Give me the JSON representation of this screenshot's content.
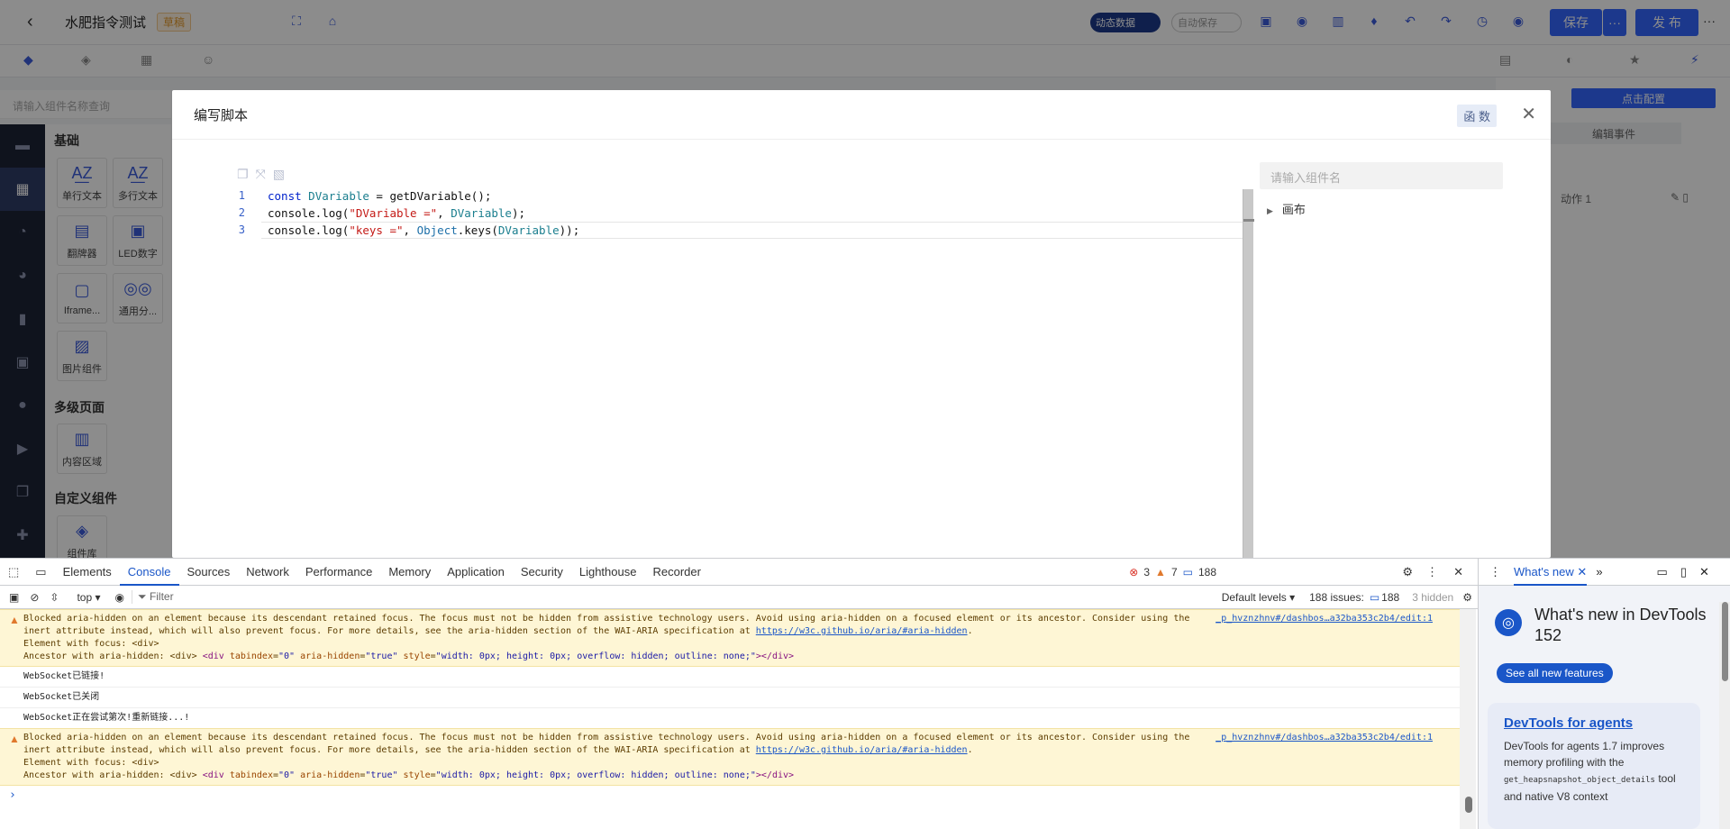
{
  "app": {
    "title": "水肥指令测试",
    "badge": "草稿",
    "dynamic_data": "动态数据",
    "auto_save": "自动保存",
    "save": "保存",
    "more": "···",
    "publish": "发 布",
    "more_right": "···"
  },
  "left": {
    "search_placeholder": "请输入组件名称查询",
    "sections": [
      "基础",
      "多级页面",
      "自定义组件"
    ],
    "components": [
      {
        "label": "单行文本",
        "icon": "A͟Z"
      },
      {
        "label": "多行文本",
        "icon": "A͟Z"
      },
      {
        "label": "翻牌器",
        "icon": "▤"
      },
      {
        "label": "LED数字",
        "icon": "▣"
      },
      {
        "label": "Iframe...",
        "icon": "▢"
      },
      {
        "label": "通用分...",
        "icon": "◎◎"
      },
      {
        "label": "图片组件",
        "icon": "▨"
      },
      {
        "label": "内容区域",
        "icon": "▥"
      },
      {
        "label": "组件库",
        "icon": "◈"
      }
    ]
  },
  "right": {
    "config_btn": "点击配置",
    "edit_event": "编辑事件",
    "action": "动作 1"
  },
  "modal": {
    "title": "编写脚本",
    "fn_button": "函 数",
    "search_placeholder": "请输入组件名",
    "tree_root": "画布",
    "lines": [
      "1",
      "2",
      "3"
    ]
  },
  "devtools": {
    "tabs": [
      "Elements",
      "Console",
      "Sources",
      "Network",
      "Performance",
      "Memory",
      "Application",
      "Security",
      "Lighthouse",
      "Recorder"
    ],
    "errors": "3",
    "warnings": "7",
    "info": "188",
    "context": "top",
    "filter": "Filter",
    "levels": "Default levels ▾",
    "issues": "188 issues:",
    "issues_count": "188",
    "hidden": "3 hidden",
    "warn_text": "Blocked aria-hidden on an element because its descendant retained focus. The focus must not be hidden from assistive technology users. Avoid using aria-hidden on a focused element or its ancestor. Consider using the",
    "warn_text2": "inert attribute instead, which will also prevent focus. For more details, see the aria-hidden section of the WAI-ARIA specification at",
    "warn_link": "https://w3c.github.io/aria/#aria-hidden",
    "warn_line3": "Element with focus: <div>",
    "warn_line4": "Ancestor with aria-hidden: <div>",
    "warn_src": "_p_hvznzhnv#/dashbos…a32ba353c2b4/edit:1",
    "msg1": "WebSocket已链接!",
    "msg2": "WebSocket已关闭",
    "msg3": "WebSocket正在尝试第次!重新链接...!"
  },
  "whatsnew": {
    "tab": "What's new",
    "title": "What's new in DevTools 152",
    "button": "See all new features",
    "card_title": "DevTools for agents",
    "card_text1": "DevTools for agents 1.7 improves memory profiling with the",
    "card_code": "get_heapsnapshot_object_details",
    "card_text2": "tool and native V8 context"
  }
}
